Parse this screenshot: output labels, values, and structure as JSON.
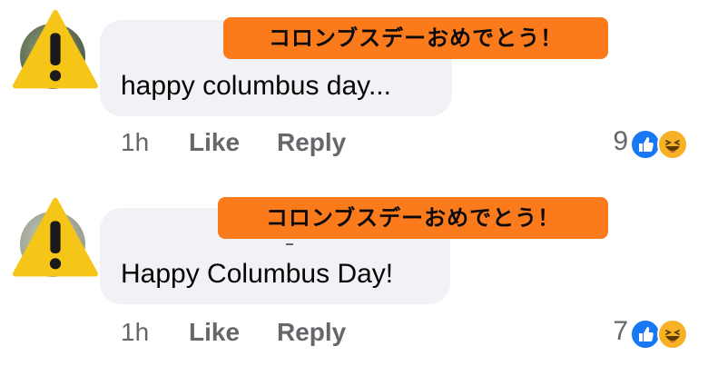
{
  "comments": [
    {
      "banner": "コロンブスデーおめでとう！",
      "text": "happy columbus day...",
      "time": "1h",
      "like_label": "Like",
      "reply_label": "Reply",
      "reaction_count": "9",
      "reactions": [
        "like-icon",
        "haha-icon"
      ]
    },
    {
      "banner": "コロンブスデーおめでとう！",
      "text": "Happy Columbus Day!",
      "time": "1h",
      "like_label": "Like",
      "reply_label": "Reply",
      "reaction_count": "7",
      "reactions": [
        "like-icon",
        "haha-icon"
      ]
    }
  ],
  "colors": {
    "banner": "#fb7a1c",
    "bubble": "#f0f2f5",
    "like_blue": "#1877f2",
    "haha_yellow": "#f7b125",
    "meta_gray": "#65676b",
    "warning_yellow": "#f5c518"
  }
}
